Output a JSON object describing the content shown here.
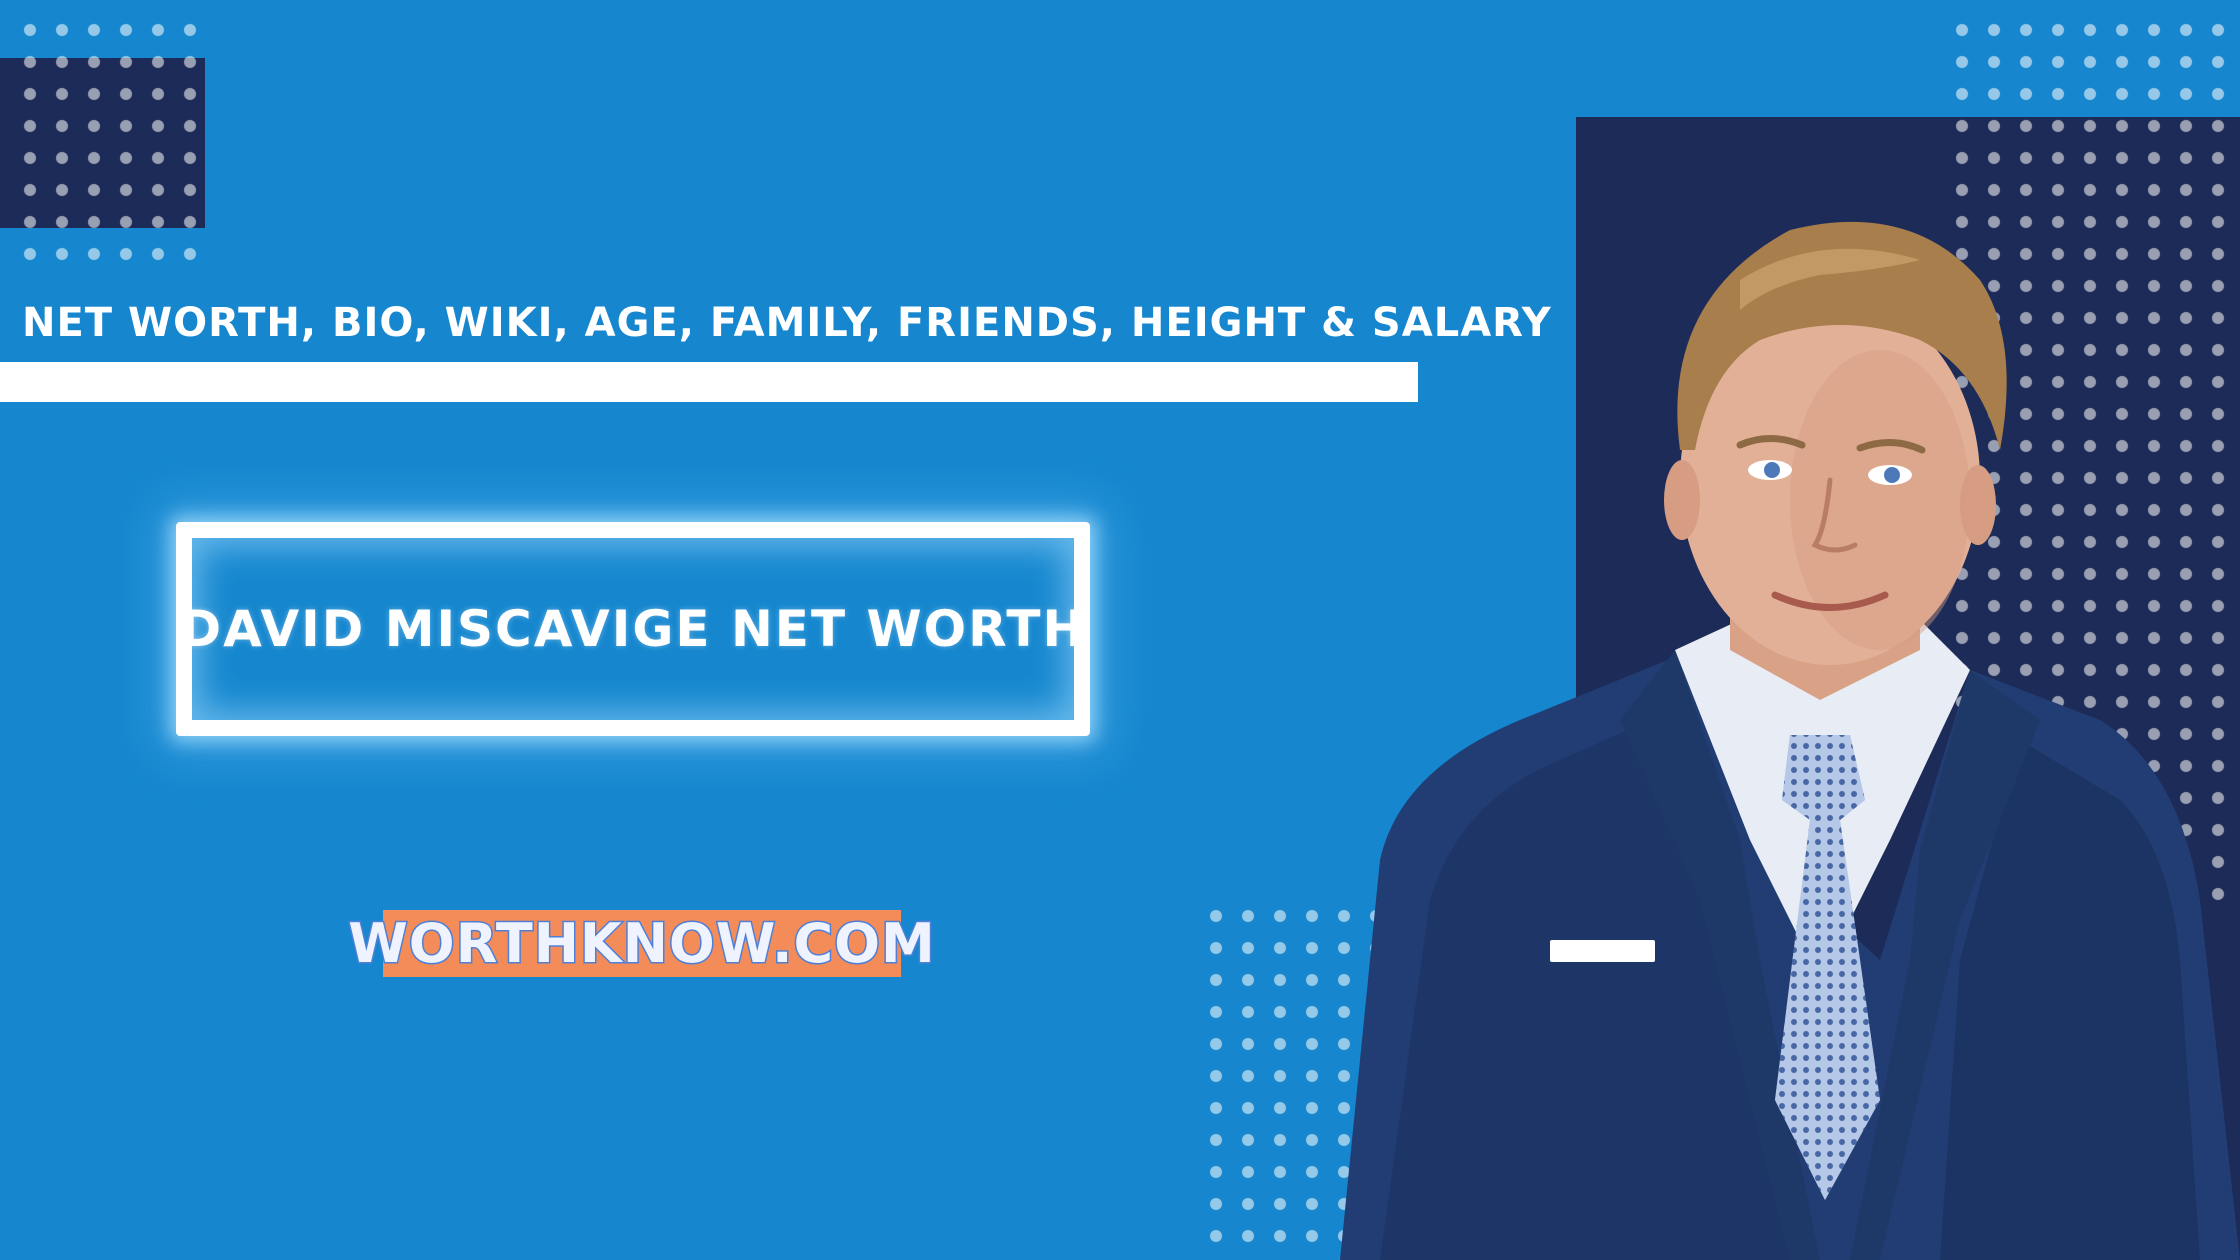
{
  "subtitle": "NET WORTH, BIO, WIKI, AGE, FAMILY, FRIENDS, HEIGHT & SALARY",
  "headline": "DAVID MISCAVIGE NET WORTH",
  "brand": "WORTHKNOW.COM",
  "colors": {
    "background": "#1687cf",
    "navy": "#1c2b57",
    "white_bar": "#ffffff",
    "badge": "#f48c5a",
    "badge_text_outline": "#4f7fd6"
  },
  "icons": {
    "portrait": "man-in-blue-suit-portrait"
  }
}
